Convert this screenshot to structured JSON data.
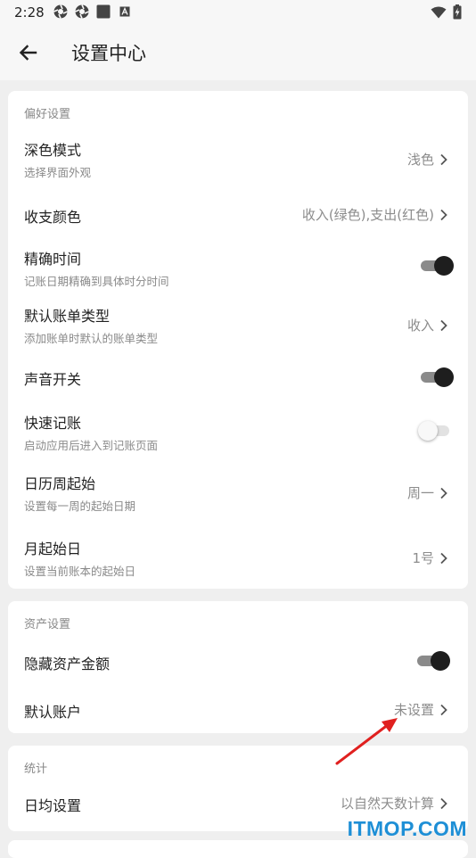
{
  "status_bar": {
    "time": "2:28"
  },
  "app_bar": {
    "title": "设置中心"
  },
  "preferences": {
    "section_title": "偏好设置",
    "dark_mode": {
      "title": "深色模式",
      "subtitle": "选择界面外观",
      "value": "浅色"
    },
    "income_expense_color": {
      "title": "收支颜色",
      "value": "收入(绿色),支出(红色)"
    },
    "precise_time": {
      "title": "精确时间",
      "subtitle": "记账日期精确到具体时分时间",
      "enabled": true
    },
    "default_bill_type": {
      "title": "默认账单类型",
      "subtitle": "添加账单时默认的账单类型",
      "value": "收入"
    },
    "sound": {
      "title": "声音开关",
      "enabled": true
    },
    "quick_entry": {
      "title": "快速记账",
      "subtitle": "启动应用后进入到记账页面",
      "enabled": false
    },
    "week_start": {
      "title": "日历周起始",
      "subtitle": "设置每一周的起始日期",
      "value": "周一"
    },
    "month_start": {
      "title": "月起始日",
      "subtitle": "设置当前账本的起始日",
      "value": "1号"
    }
  },
  "assets": {
    "section_title": "资产设置",
    "hide_amount": {
      "title": "隐藏资产金额",
      "enabled": true
    },
    "default_account": {
      "title": "默认账户",
      "value": "未设置"
    }
  },
  "statistics": {
    "section_title": "统计",
    "daily_average": {
      "title": "日均设置",
      "value": "以自然天数计算"
    }
  },
  "watermark": "ITMOP.COM",
  "colors": {
    "background": "#efefef",
    "card": "#ffffff",
    "toggle_on": "#1e1e1e",
    "annotation_arrow": "#e0201f",
    "watermark": "#1e8fd6"
  }
}
